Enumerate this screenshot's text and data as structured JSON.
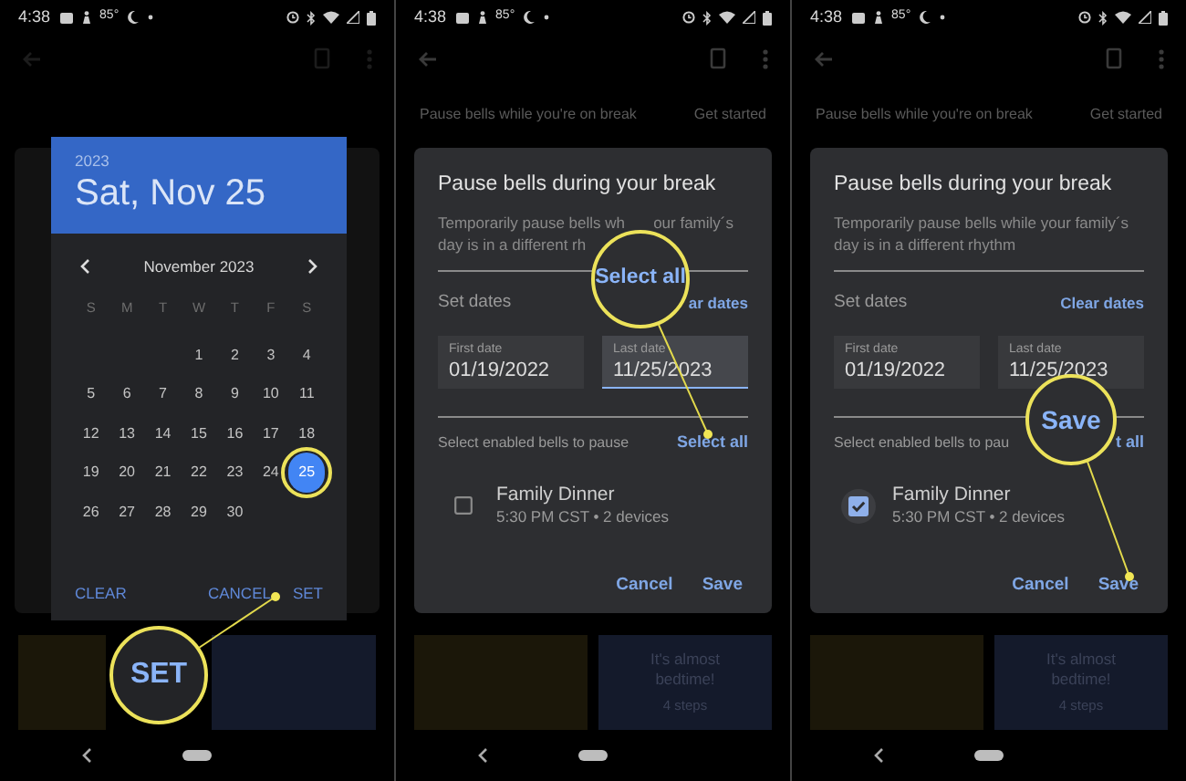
{
  "panels": [
    {
      "kind": "date_picker",
      "status_bar": {
        "time": "4:38",
        "temperature": "85°"
      },
      "picker": {
        "year": "2023",
        "date": "Sat, Nov 25",
        "month": "November 2023",
        "weekdays": [
          "S",
          "M",
          "T",
          "W",
          "T",
          "F",
          "S"
        ],
        "weeks": [
          [
            {
              "label": "1",
              "selected": false,
              "highlighted": false
            },
            {
              "label": "2",
              "selected": false,
              "highlighted": false
            },
            {
              "label": "3",
              "selected": false,
              "highlighted": false
            },
            {
              "label": "4",
              "selected": false,
              "highlighted": false
            }
          ],
          [
            {
              "label": "5",
              "selected": false,
              "highlighted": false
            },
            {
              "label": "6",
              "selected": false,
              "highlighted": false
            },
            {
              "label": "7",
              "selected": false,
              "highlighted": false
            },
            {
              "label": "8",
              "selected": false,
              "highlighted": false
            },
            {
              "label": "9",
              "selected": false,
              "highlighted": false
            },
            {
              "label": "10",
              "selected": false,
              "highlighted": false
            },
            {
              "label": "11",
              "selected": false,
              "highlighted": false
            }
          ],
          [
            {
              "label": "12",
              "selected": false,
              "highlighted": false
            },
            {
              "label": "13",
              "selected": false,
              "highlighted": false
            },
            {
              "label": "14",
              "selected": false,
              "highlighted": false
            },
            {
              "label": "15",
              "selected": false,
              "highlighted": false
            },
            {
              "label": "16",
              "selected": false,
              "highlighted": false
            },
            {
              "label": "17",
              "selected": false,
              "highlighted": false
            },
            {
              "label": "18",
              "selected": false,
              "highlighted": false
            }
          ],
          [
            {
              "label": "19",
              "selected": false,
              "highlighted": false
            },
            {
              "label": "20",
              "selected": false,
              "highlighted": false
            },
            {
              "label": "21",
              "selected": false,
              "highlighted": false
            },
            {
              "label": "22",
              "selected": false,
              "highlighted": false
            },
            {
              "label": "23",
              "selected": false,
              "highlighted": false
            },
            {
              "label": "24",
              "selected": false,
              "highlighted": false
            },
            {
              "label": "25",
              "selected": true,
              "highlighted": true
            }
          ],
          [
            {
              "label": "26",
              "selected": false,
              "highlighted": false
            },
            {
              "label": "27",
              "selected": false,
              "highlighted": false
            },
            {
              "label": "28",
              "selected": false,
              "highlighted": false
            },
            {
              "label": "29",
              "selected": false,
              "highlighted": false
            },
            {
              "label": "30",
              "selected": false,
              "highlighted": false
            }
          ]
        ],
        "buttons": [
          "CLEAR",
          "CANCEL",
          "SET"
        ]
      },
      "callout": {
        "text": "SET"
      }
    },
    {
      "kind": "pause_dialog",
      "status_bar": {
        "time": "4:38",
        "temperature": "85°"
      },
      "banner": {
        "text": "Pause bells while you're on break",
        "action": "Get started"
      },
      "dialog": {
        "title": "Pause bells during your break",
        "description": [
          {
            "left": "Temporarily pause bells wh",
            "right": "our family´s"
          },
          {
            "left": "day is in a different rh"
          }
        ],
        "set_dates": "Set dates",
        "clear_dates": "ar dates",
        "fields": [
          {
            "label": "First date",
            "value": "01/19/2022",
            "selected": false
          },
          {
            "label": "Last date",
            "value": "11/25/2023",
            "selected": true
          }
        ],
        "bells_label": {
          "left": "Select enabled bells to pause",
          "right": "Select all"
        },
        "bells": [
          {
            "name": "Family Dinner",
            "detail": "5:30 PM CST • 2 devices",
            "checked": false
          }
        ],
        "buttons": [
          "Cancel",
          "Save"
        ]
      },
      "card": {
        "text": "It's almost bedtime!",
        "detail": "4 steps"
      },
      "callout": {
        "text": "Select all"
      }
    },
    {
      "kind": "pause_dialog",
      "status_bar": {
        "time": "4:38",
        "temperature": "85°"
      },
      "banner": {
        "text": "Pause bells while you're on break",
        "action": "Get started"
      },
      "dialog": {
        "title": "Pause bells during your break",
        "description": [
          {
            "left": "Temporarily pause bells while your family´s"
          },
          {
            "left": "day is in a different rhythm"
          }
        ],
        "set_dates": "Set dates",
        "clear_dates": "Clear dates",
        "fields": [
          {
            "label": "First date",
            "value": "01/19/2022",
            "selected": false
          },
          {
            "label": "Last date",
            "value": "11/25/2023",
            "selected": false
          }
        ],
        "bells_label": {
          "left": "Select enabled bells to pau",
          "right": "t all"
        },
        "bells": [
          {
            "name": "Family Dinner",
            "detail": "5:30 PM CST • 2 devices",
            "checked": true
          }
        ],
        "buttons": [
          "Cancel",
          "Save"
        ]
      },
      "card": {
        "text": "It's almost bedtime!",
        "detail": "4 steps"
      },
      "callout": {
        "text": "Save"
      }
    }
  ]
}
